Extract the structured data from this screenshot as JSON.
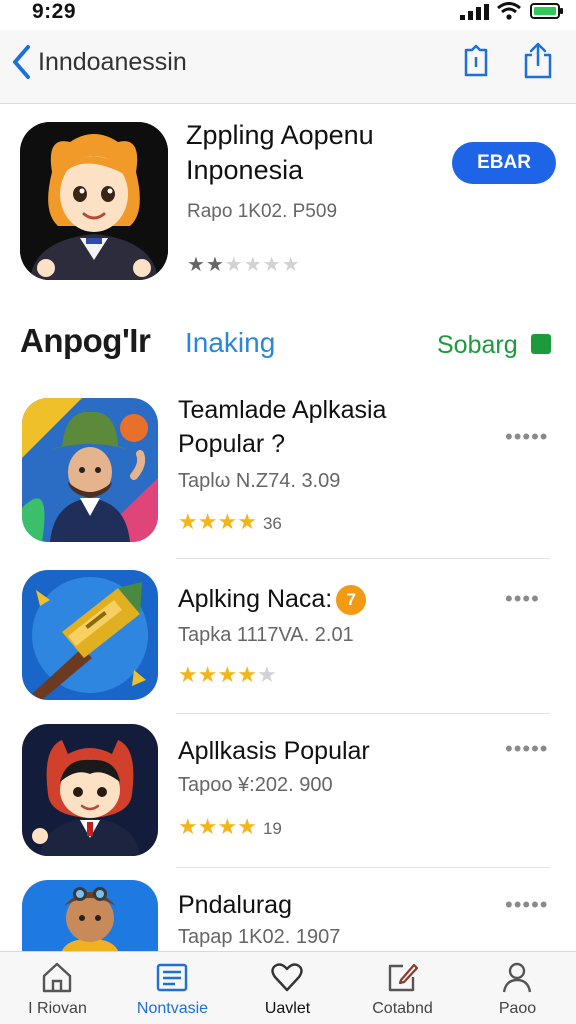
{
  "status_bar": {
    "time": "9:29"
  },
  "nav": {
    "title": "Inndoanessin"
  },
  "featured": {
    "title_line1": "Zppling Aopenu",
    "title_line2": "Inponesia",
    "meta": "Rapo 1K02. P509",
    "get_label": "EBAR",
    "rating_stars": 2
  },
  "section": {
    "title": "Anpog'Ir",
    "tab": "Inaking",
    "link": "Sobarg"
  },
  "apps": [
    {
      "name_line1": "Teamlade Aplkasia",
      "name_line2": "Popular ?",
      "meta": "Taplω N.Z74. 3.09",
      "stars": 4,
      "count": "36"
    },
    {
      "name_line1": "Aplking Naca:",
      "badge": "7",
      "meta": "Tapka 1117VA. 2.01",
      "stars": 3.5
    },
    {
      "name_line1": "Apllkasis Popular",
      "meta": "Tapoo ¥:202. 900",
      "stars": 4,
      "count": "19"
    },
    {
      "name_line1": "Pndalurag",
      "meta": "Tapap 1K02. 1907"
    }
  ],
  "tabs": [
    {
      "label": "I Riovan",
      "icon": "home-icon"
    },
    {
      "label": "Nontvasie",
      "icon": "list-icon"
    },
    {
      "label": "Uavlet",
      "icon": "heart-icon"
    },
    {
      "label": "Cotabnd",
      "icon": "edit-icon"
    },
    {
      "label": "Paoo",
      "icon": "person-icon"
    }
  ],
  "colors": {
    "accent": "#1e64e6",
    "link_green": "#1c9a3c",
    "star_gold": "#f2b61a",
    "badge_orange": "#f29a14"
  }
}
